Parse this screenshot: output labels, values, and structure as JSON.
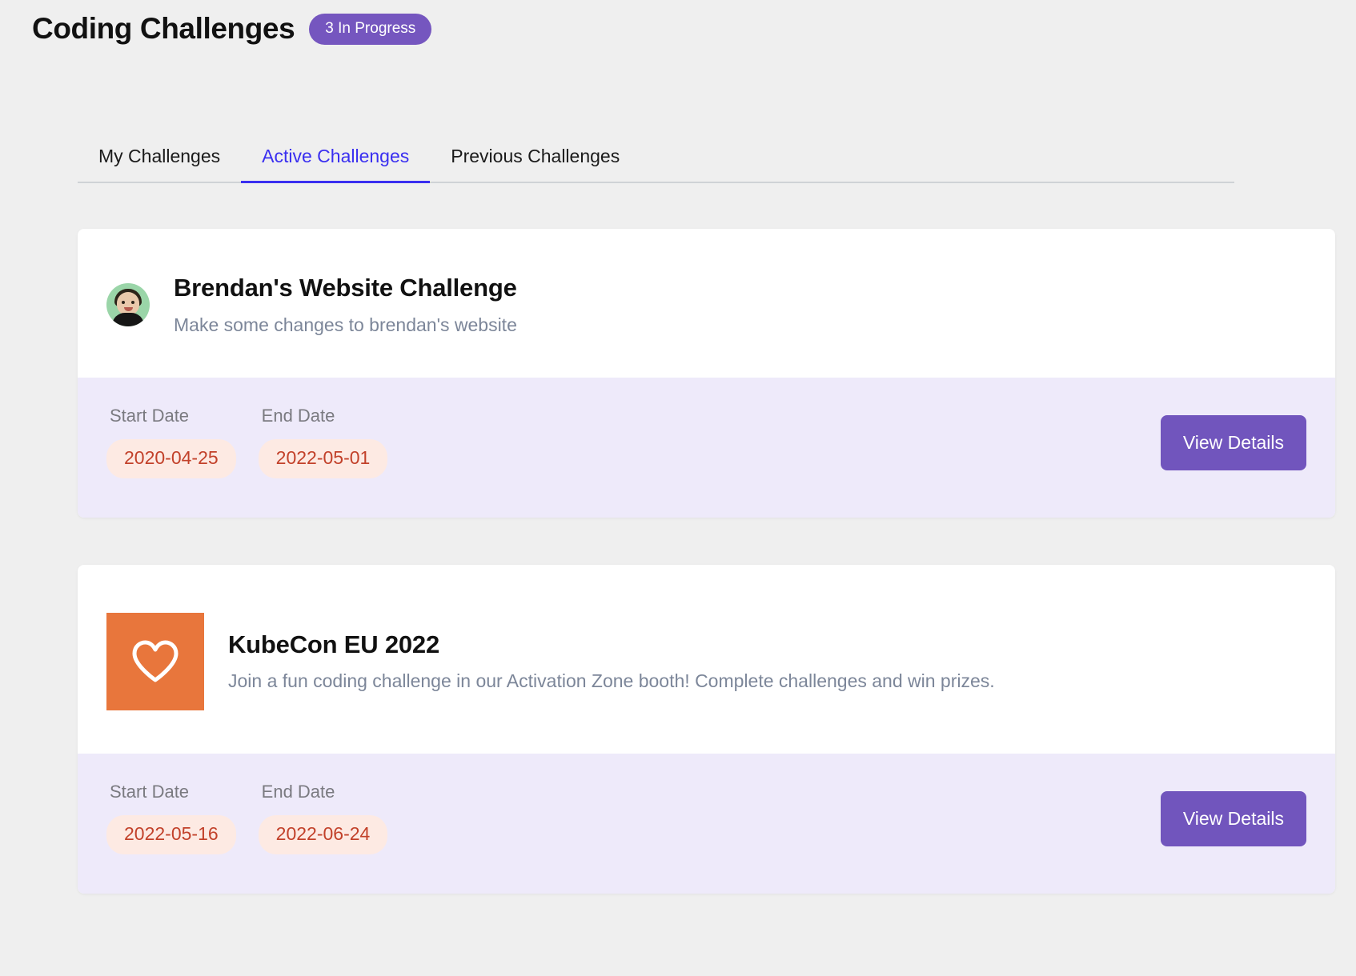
{
  "header": {
    "title": "Coding Challenges",
    "badge": "3 In Progress"
  },
  "tabs": [
    {
      "label": "My Challenges",
      "active": false
    },
    {
      "label": "Active Challenges",
      "active": true
    },
    {
      "label": "Previous Challenges",
      "active": false
    }
  ],
  "labels": {
    "start_date": "Start Date",
    "end_date": "End Date",
    "view_details": "View Details"
  },
  "colors": {
    "page_background": "#efefef",
    "badge_purple": "#7556bf",
    "active_tab_blue": "#3a2ff0",
    "tab_border": "#cfd2d6",
    "card_white": "#ffffff",
    "card_footer_lavender": "#eeeafa",
    "date_pill_background": "#fdeae3",
    "date_pill_text": "#c2412a",
    "button_purple": "#7155bd",
    "icon_tile_orange": "#e8763c",
    "description_grey": "#7c8699",
    "label_grey": "#7a7a80"
  },
  "cards": [
    {
      "icon": "avatar-photo",
      "title": "Brendan's Website Challenge",
      "description": "Make some changes to brendan's website",
      "start_date_label": "Start Date",
      "end_date_label": "End Date",
      "start_date": "2020-04-25",
      "end_date": "2022-05-01",
      "button_label": "View Details"
    },
    {
      "icon": "heart-icon",
      "title": "KubeCon EU 2022",
      "description": "Join a fun coding challenge in our Activation Zone booth! Complete challenges and win prizes.",
      "start_date_label": "Start Date",
      "end_date_label": "End Date",
      "start_date": "2022-05-16",
      "end_date": "2022-06-24",
      "button_label": "View Details"
    }
  ]
}
